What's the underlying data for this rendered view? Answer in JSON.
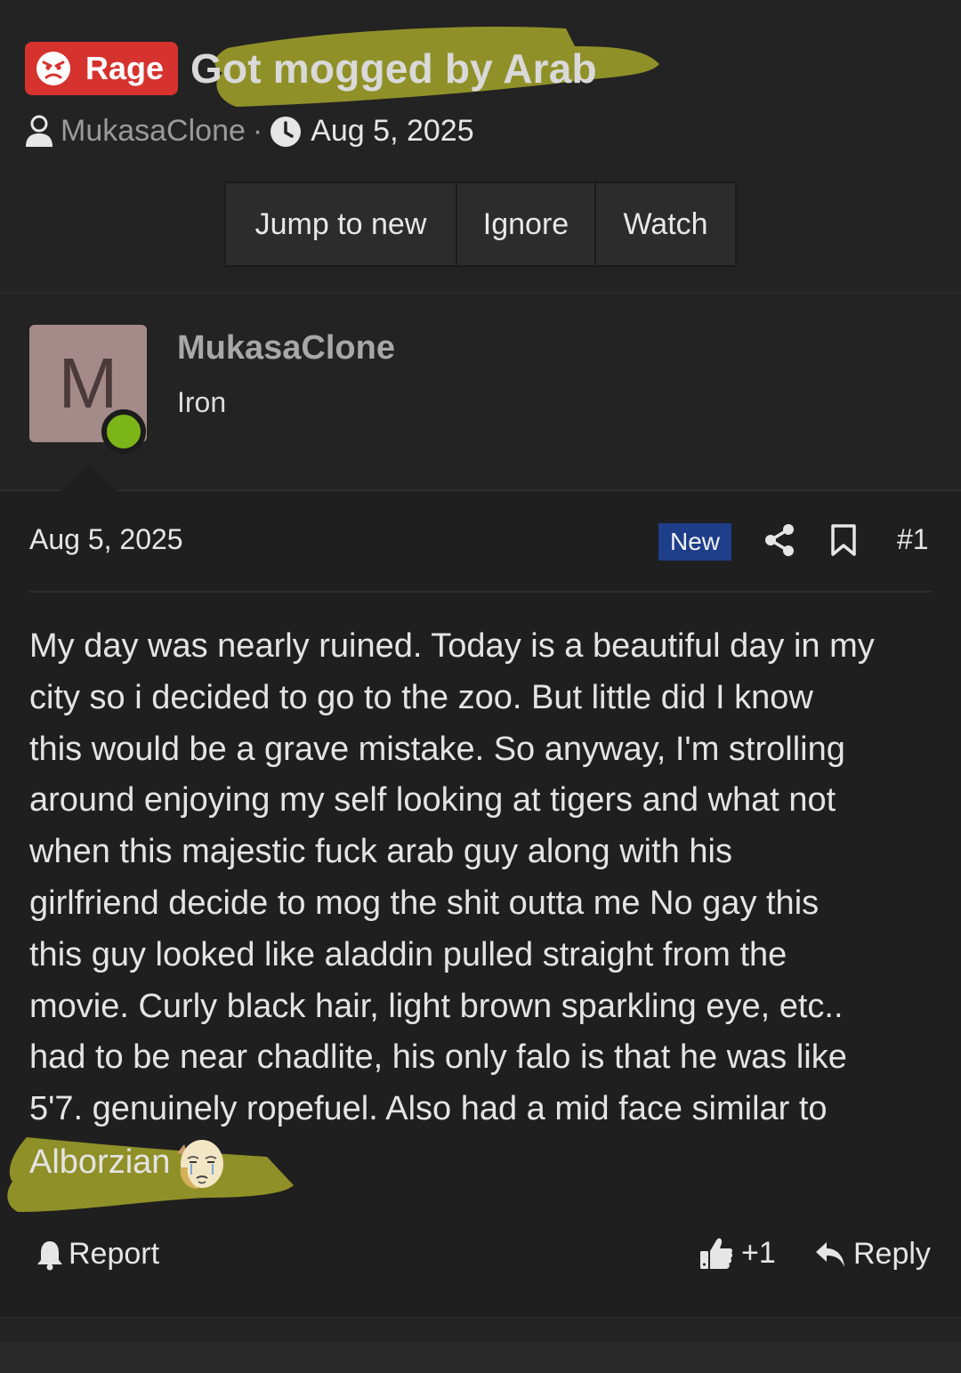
{
  "thread": {
    "prefix_label": "Rage",
    "title": "Got mogged by Arab",
    "author": "MukasaClone",
    "separator": "·",
    "date": "Aug 5, 2025",
    "actions": {
      "jump_label": "Jump to new",
      "ignore_label": "Ignore",
      "watch_label": "Watch"
    }
  },
  "post": {
    "avatar_letter": "M",
    "username": "MukasaClone",
    "user_title": "Iron",
    "date": "Aug 5, 2025",
    "new_badge": "New",
    "post_number": "#1",
    "body_lines": [
      "My day was nearly ruined. Today is a beautiful day in my",
      "city so i decided to go to the zoo. But little did I know",
      "this would be a grave mistake. So anyway, I'm strolling",
      "around enjoying my self looking at tigers and what not",
      "when this majestic fuck arab guy along with his",
      "girlfriend decide to mog the shit outta me No gay this",
      "this guy looked like aladdin pulled straight from the",
      "movie. Curly black hair, light brown sparkling eye, etc..",
      "had to be near chadlite, his only falo is that he was like",
      "5'7. genuinely ropefuel. Also had a mid face similar to"
    ],
    "mention": "Alborzian",
    "footer": {
      "report_label": "Report",
      "like_count": "+1",
      "reply_label": "Reply"
    }
  },
  "icons": {
    "prefix": "angry-face-icon",
    "author": "user-icon",
    "date": "clock-icon",
    "share": "share-icon",
    "bookmark": "bookmark-icon",
    "report": "bell-icon",
    "like": "thumbs-up-icon",
    "reply": "reply-icon"
  },
  "colors": {
    "background": "#232323",
    "post_background": "#1f1f1f",
    "prefix_red": "#d6332f",
    "new_badge_blue": "#1e3e8a",
    "online_green": "#7cb518",
    "highlighter_yellow": "#9a9a2a",
    "avatar_bg": "#a58a8a"
  }
}
